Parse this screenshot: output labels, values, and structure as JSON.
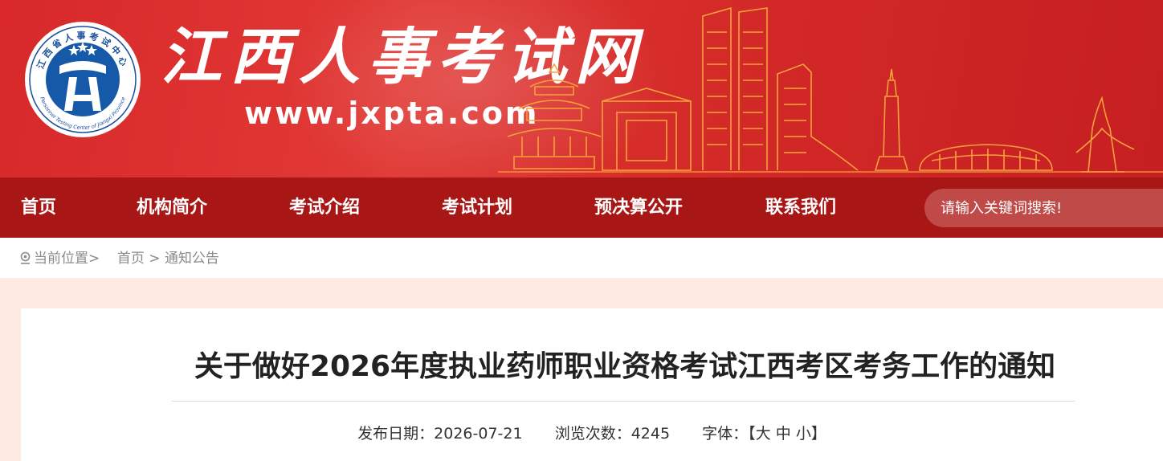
{
  "header": {
    "logo_ring_text": "江西省人事考试中心",
    "logo_ring_text_en": "Personnel Testing Center of Jiangxi Province",
    "site_title": "江西人事考试网",
    "site_url": "www.jxpta.com"
  },
  "nav": {
    "items": [
      {
        "label": "首页"
      },
      {
        "label": "机构简介"
      },
      {
        "label": "考试介绍"
      },
      {
        "label": "考试计划"
      },
      {
        "label": "预决算公开"
      },
      {
        "label": "联系我们"
      }
    ],
    "search_placeholder": "请输入关键词搜索!"
  },
  "breadcrumb": {
    "prefix": "当前位置>",
    "home": "首页",
    "sep": ">",
    "current": "通知公告"
  },
  "article": {
    "title": "关于做好2026年度执业药师职业资格考试江西考区考务工作的通知",
    "date_label": "发布日期：",
    "date": "2026-07-21",
    "views_label": "浏览次数：",
    "views": "4245",
    "font_label": "字体：",
    "font_open": "【",
    "font_large": "大",
    "font_medium": "中",
    "font_small": "小",
    "font_close": "】"
  },
  "colors": {
    "banner_red": "#d8282a",
    "nav_red": "#a81616",
    "search_bg": "#bf4a48",
    "page_bg": "#fdebe2",
    "skyline_orange": "#f6a23a"
  }
}
